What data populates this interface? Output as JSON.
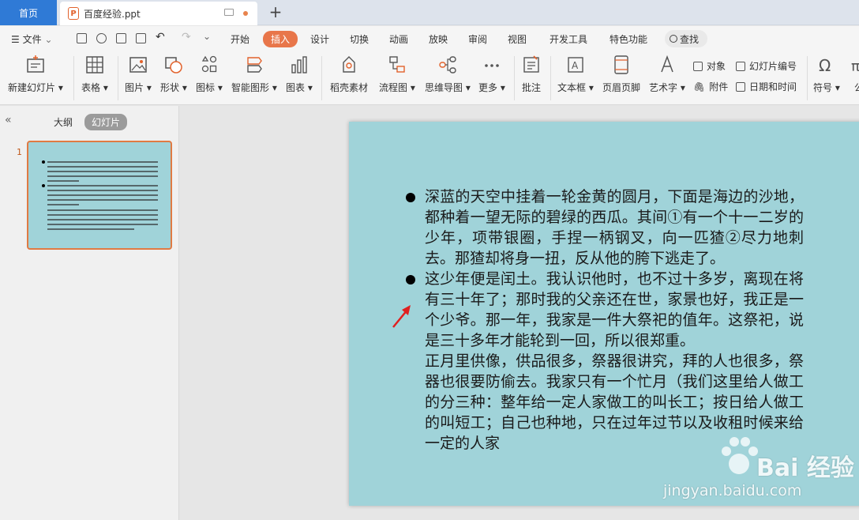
{
  "titlebar": {
    "home_tab": "首页",
    "doc_tab": "百度经验.ppt",
    "file_icon": "P",
    "new_tab": "+"
  },
  "menu": {
    "file": "文件",
    "tabs": [
      "开始",
      "插入",
      "设计",
      "切换",
      "动画",
      "放映",
      "审阅",
      "视图",
      "开发工具",
      "特色功能"
    ],
    "search": "查找"
  },
  "ribbon": {
    "new_slide": "新建幻灯片",
    "table": "表格",
    "picture": "图片",
    "shape": "形状",
    "icon": "图标",
    "smart_art": "智能图形",
    "chart": "图表",
    "material": "稻壳素材",
    "flowchart": "流程图",
    "mindmap": "思维导图",
    "more": "更多",
    "comment": "批注",
    "textbox": "文本框",
    "header_footer": "页眉页脚",
    "wordart": "艺术字",
    "object": "对象",
    "attachment": "附件",
    "slide_number": "幻灯片编号",
    "datetime": "日期和时间",
    "symbol": "符号",
    "formula": "公"
  },
  "left_panel": {
    "collapse": "«",
    "tab_outline": "大纲",
    "tab_slides": "幻灯片",
    "slide_number": "1"
  },
  "slide": {
    "para1": "深蓝的天空中挂着一轮金黄的圆月，下面是海边的沙地，都种着一望无际的碧绿的西瓜。其间①有一个十一二岁的少年，项带银圈，手捏一柄钢叉，向一匹猹②尽力地刺去。那猹却将身一扭，反从他的胯下逃走了。",
    "para2": "这少年便是闰土。我认识他时，也不过十多岁，离现在将有三十年了；那时我的父亲还在世，家景也好，我正是一个少爷。那一年，我家是一件大祭祀的值年。这祭祀，说是三十多年才能轮到一回，所以很郑重。",
    "para3": "正月里供像，供品很多，祭器很讲究，拜的人也很多，祭器也很要防偷去。我家只有一个忙月（我们这里给人做工的分三种：整年给一定人家做工的叫长工；按日给人做工的叫短工；自己也种地，只在过年过节以及收租时候来给一定的人家"
  },
  "watermark": {
    "brand": "Bai 经验",
    "url": "jingyan.baidu.com"
  },
  "colors": {
    "home_tab": "#2f7ad6",
    "insert_tab": "#e8764a",
    "slide_bg": "#a0d3d9",
    "arrow": "#e02020",
    "thumb_border": "#e07a43"
  }
}
